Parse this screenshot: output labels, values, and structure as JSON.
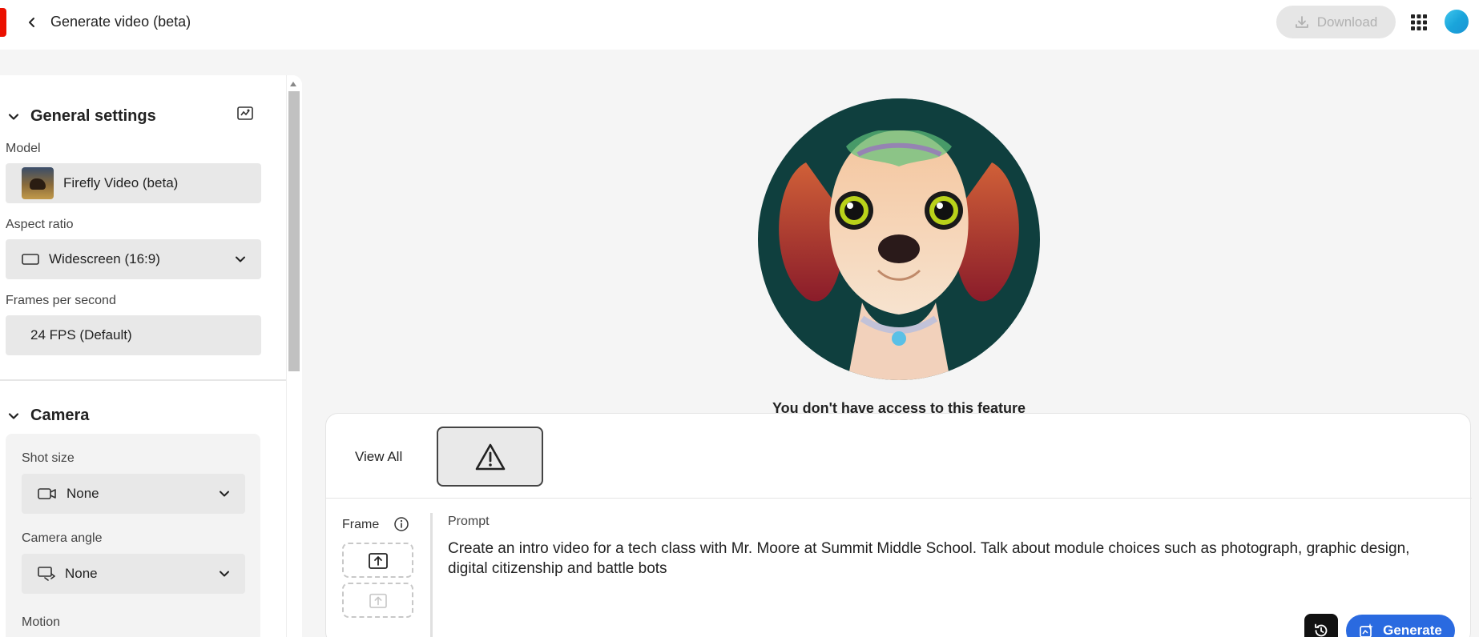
{
  "header": {
    "title": "Generate video (beta)",
    "download_label": "Download"
  },
  "sidebar": {
    "general": {
      "title": "General settings",
      "model_label": "Model",
      "model_value": "Firefly Video (beta)",
      "aspect_label": "Aspect ratio",
      "aspect_value": "Widescreen (16:9)",
      "fps_label": "Frames per second",
      "fps_value": "24 FPS (Default)"
    },
    "camera": {
      "title": "Camera",
      "shot_label": "Shot size",
      "shot_value": "None",
      "angle_label": "Camera angle",
      "angle_value": "None",
      "motion_label": "Motion"
    }
  },
  "main": {
    "access_message": "You don't have access to this feature"
  },
  "prompt_panel": {
    "view_all": "View All",
    "frame_label": "Frame",
    "prompt_label": "Prompt",
    "prompt_text": "Create an intro video for a tech class with Mr. Moore at Summit Middle School.  Talk about module choices such as photograph, graphic design, digital citizenship and battle bots",
    "generate_label": "Generate"
  },
  "colors": {
    "brand_red": "#eb1000",
    "generate_blue": "#2a6ae0",
    "avatar_cyan": "#1aa5db"
  },
  "icons": {
    "back": "chevron-left-icon",
    "download": "download-icon",
    "apps": "apps-grid-icon",
    "warning": "warning-triangle-icon",
    "info": "info-icon",
    "upload": "upload-icon",
    "history": "history-icon",
    "generate": "generate-sparkle-icon"
  }
}
